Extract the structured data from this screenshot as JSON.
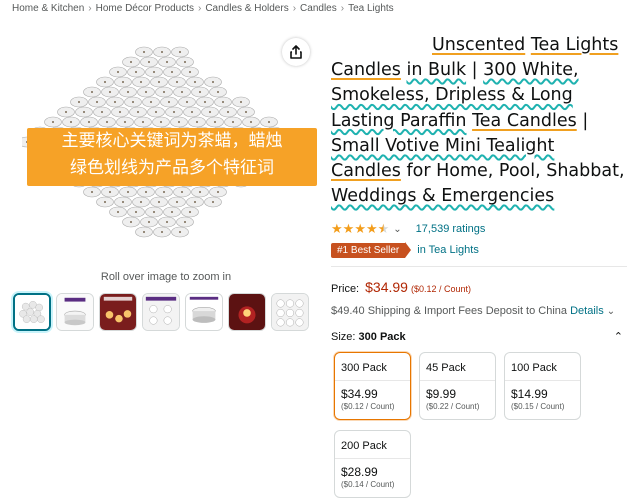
{
  "breadcrumb": [
    "Home & Kitchen",
    "Home Décor Products",
    "Candles & Holders",
    "Candles",
    "Tea Lights"
  ],
  "gallery": {
    "zoom_hint": "Roll over image to zoom in",
    "overlay_lines": [
      "主要核心关键词为茶蜡，蜡烛",
      "绿色划线为产品多个特征词"
    ],
    "thumbnail_count": 7
  },
  "title_segments": [
    {
      "text": "Unscented",
      "style": "orange"
    },
    {
      "text": " ",
      "style": "plain"
    },
    {
      "text": "Tea Lights",
      "style": "orange"
    },
    {
      "text": " ",
      "style": "plain"
    },
    {
      "text": "Candles",
      "style": "orange"
    },
    {
      "text": " ",
      "style": "plain"
    },
    {
      "text": "in Bulk",
      "style": "wavy"
    },
    {
      "text": " | ",
      "style": "plain"
    },
    {
      "text": "300 White,",
      "style": "wavy"
    },
    {
      "text": " ",
      "style": "plain"
    },
    {
      "text": "Smokeless, Dripless & Long Lasting Paraffin",
      "style": "wavy"
    },
    {
      "text": " ",
      "style": "plain"
    },
    {
      "text": "Tea Candles",
      "style": "orange"
    },
    {
      "text": " | ",
      "style": "plain"
    },
    {
      "text": "Small Votive Mini Tealight",
      "style": "wavy"
    },
    {
      "text": " ",
      "style": "plain"
    },
    {
      "text": "Candles",
      "style": "orange"
    },
    {
      "text": " for Home, Pool, Shabbat, ",
      "style": "plain"
    },
    {
      "text": "Weddings & Emergencies",
      "style": "wavy"
    }
  ],
  "rating": {
    "stars": 4.5,
    "count_label": "17,539 ratings"
  },
  "best_seller": {
    "badge": "#1 Best Seller",
    "category": "in Tea Lights"
  },
  "price": {
    "label": "Price:",
    "value": "$34.99",
    "unit": "($0.12 / Count)"
  },
  "shipping": {
    "text": "$49.40 Shipping & Import Fees Deposit to China",
    "details_link": "Details"
  },
  "size": {
    "label": "Size:",
    "selected": "300 Pack"
  },
  "size_options": [
    {
      "name": "300 Pack",
      "price": "$34.99",
      "unit": "($0.12 / Count)",
      "selected": true
    },
    {
      "name": "45 Pack",
      "price": "$9.99",
      "unit": "($0.22 / Count)",
      "selected": false
    },
    {
      "name": "100 Pack",
      "price": "$14.99",
      "unit": "($0.15 / Count)",
      "selected": false
    },
    {
      "name": "200 Pack",
      "price": "$28.99",
      "unit": "($0.14 / Count)",
      "selected": false
    }
  ],
  "colors": {
    "link": "#007185",
    "price": "#b12704",
    "star": "#f39d1b",
    "badge": "#c7511f",
    "overlay": "#f6a227",
    "orange_underline": "#f0a020",
    "wavy_underline": "#1fb2b0"
  }
}
